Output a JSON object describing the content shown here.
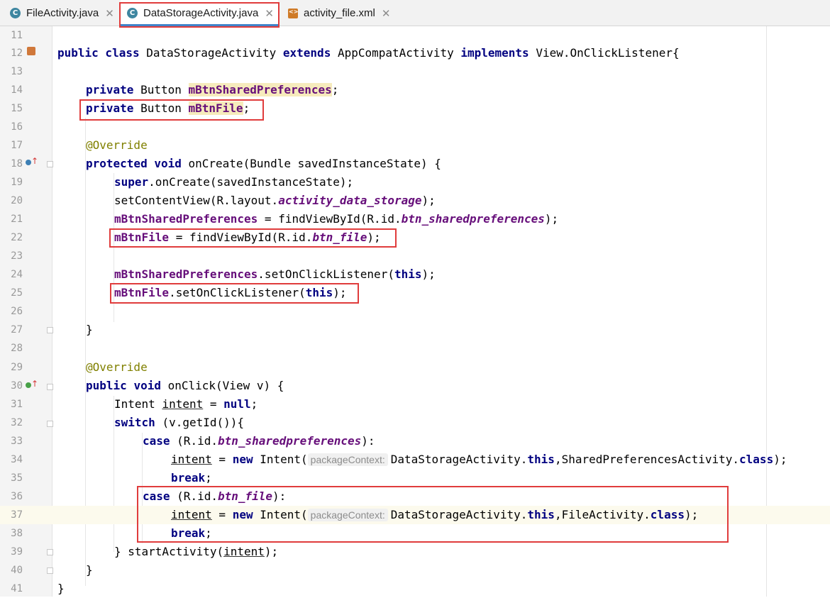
{
  "tabs": [
    {
      "label": "FileActivity.java",
      "icon": "class-icon",
      "icon_letter": "C",
      "active": false
    },
    {
      "label": "DataStorageActivity.java",
      "icon": "class-icon",
      "icon_letter": "C",
      "active": true
    },
    {
      "label": "activity_file.xml",
      "icon": "xml-layout-icon",
      "active": false
    }
  ],
  "close_glyph": "✕",
  "colors": {
    "keyword": "#000080",
    "field": "#660e7a",
    "annotation": "#808000",
    "highlight_box": "#e03c3c",
    "tab_underline": "#4083c9"
  },
  "code": {
    "line_numbers": [
      "11",
      "12",
      "13",
      "14",
      "15",
      "16",
      "17",
      "18",
      "19",
      "20",
      "21",
      "22",
      "23",
      "24",
      "25",
      "26",
      "27",
      "28",
      "29",
      "30",
      "31",
      "32",
      "33",
      "34",
      "35",
      "36",
      "37",
      "38",
      "39",
      "40",
      "41"
    ],
    "l12": {
      "kw1": "public class ",
      "t1": "DataStorageActivity ",
      "kw2": "extends ",
      "t2": "AppCompatActivity ",
      "kw3": "implements ",
      "t3": "View.OnClickListener{"
    },
    "l14": {
      "kw": "private ",
      "type": "Button ",
      "field": "mBtnSharedPreferences",
      "end": ";"
    },
    "l15": {
      "kw": "private ",
      "type": "Button ",
      "field": "mBtnFile",
      "end": ";"
    },
    "l17": {
      "ann": "@Override"
    },
    "l18": {
      "kw1": "protected ",
      "kw2": "void ",
      "text": "onCreate(Bundle savedInstanceState) {"
    },
    "l19": {
      "kw": "super",
      "text": ".onCreate(savedInstanceState);"
    },
    "l20": {
      "t1": "setContentView(R.layout.",
      "st": "activity_data_storage",
      "t2": ");"
    },
    "l21": {
      "field": "mBtnSharedPreferences",
      "t1": " = findViewById(R.id.",
      "st": "btn_sharedpreferences",
      "t2": ");"
    },
    "l22": {
      "field": "mBtnFile",
      "t1": " = findViewById(R.id.",
      "st": "btn_file",
      "t2": ");"
    },
    "l24": {
      "field": "mBtnSharedPreferences",
      "t1": ".setOnClickListener(",
      "kw": "this",
      "t2": ");"
    },
    "l25": {
      "field": "mBtnFile",
      "t1": ".setOnClickListener(",
      "kw": "this",
      "t2": ");"
    },
    "l27": {
      "text": "}"
    },
    "l29": {
      "ann": "@Override"
    },
    "l30": {
      "kw1": "public ",
      "kw2": "void ",
      "text": "onClick(View v) {"
    },
    "l31": {
      "t1": "Intent ",
      "var": "intent",
      "t2": " = ",
      "kw": "null",
      "t3": ";"
    },
    "l32": {
      "kw": "switch ",
      "text": "(v.getId()){"
    },
    "l33": {
      "kw": "case ",
      "t1": "(R.id.",
      "st": "btn_sharedpreferences",
      "t2": "):"
    },
    "l34": {
      "var": "intent",
      "t1": " = ",
      "kw1": "new ",
      "t2": "Intent(",
      "hint": "packageContext:",
      "t3": "DataStorageActivity.",
      "kw2": "this",
      "t4": ",SharedPreferencesActivity.",
      "kw3": "class",
      "t5": ");"
    },
    "l35": {
      "kw": "break",
      "t1": ";"
    },
    "l36": {
      "kw": "case ",
      "t1": "(R.id.",
      "st": "btn_file",
      "t2": "):"
    },
    "l37": {
      "var": "intent",
      "t1": " = ",
      "kw1": "new ",
      "t2": "Intent(",
      "hint": "packageContext:",
      "t3": "DataStorageActivity.",
      "kw2": "this",
      "t4": ",FileActivity.",
      "kw3": "class",
      "t5": ");"
    },
    "l38": {
      "kw": "break",
      "t1": ";"
    },
    "l39": {
      "t1": "} startActivity(",
      "var": "intent",
      "t2": ");"
    },
    "l40": {
      "text": "}"
    },
    "l41": {
      "text": "}"
    }
  }
}
